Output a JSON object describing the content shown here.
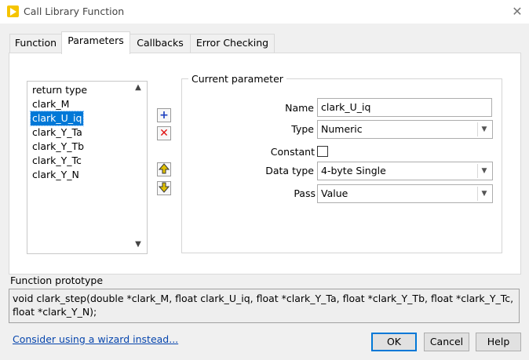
{
  "window": {
    "title": "Call Library Function",
    "close_glyph": "✕"
  },
  "tabs": [
    {
      "label": "Function"
    },
    {
      "label": "Parameters"
    },
    {
      "label": "Callbacks"
    },
    {
      "label": "Error Checking"
    }
  ],
  "active_tab": "Parameters",
  "parameter_list": {
    "items": [
      "return type",
      "clark_M",
      "clark_U_iq",
      "clark_Y_Ta",
      "clark_Y_Tb",
      "clark_Y_Tc",
      "clark_Y_N"
    ],
    "selected": "clark_U_iq"
  },
  "list_buttons": {
    "add_icon": "plus-icon",
    "remove_icon": "x-icon",
    "up_icon": "arrow-up-icon",
    "down_icon": "arrow-down-icon",
    "add_color": "#1d3fbf",
    "remove_color": "#e01010",
    "move_color": "#e0c000"
  },
  "current_parameter": {
    "group_title": "Current parameter",
    "name_label": "Name",
    "name_value": "clark_U_iq",
    "type_label": "Type",
    "type_value": "Numeric",
    "constant_label": "Constant",
    "constant_checked": false,
    "data_type_label": "Data type",
    "data_type_value": "4-byte Single",
    "pass_label": "Pass",
    "pass_value": "Value"
  },
  "prototype": {
    "label": "Function prototype",
    "text": "void  clark_step(double *clark_M, float clark_U_iq, float *clark_Y_Ta, float *clark_Y_Tb, float *clark_Y_Tc, float *clark_Y_N);"
  },
  "footer": {
    "wizard_link": "Consider using a wizard instead...",
    "ok_label": "OK",
    "cancel_label": "Cancel",
    "help_label": "Help"
  },
  "colors": {
    "selection": "#0078d7",
    "link": "#0645ad",
    "accent_icon": "#f5c400"
  }
}
